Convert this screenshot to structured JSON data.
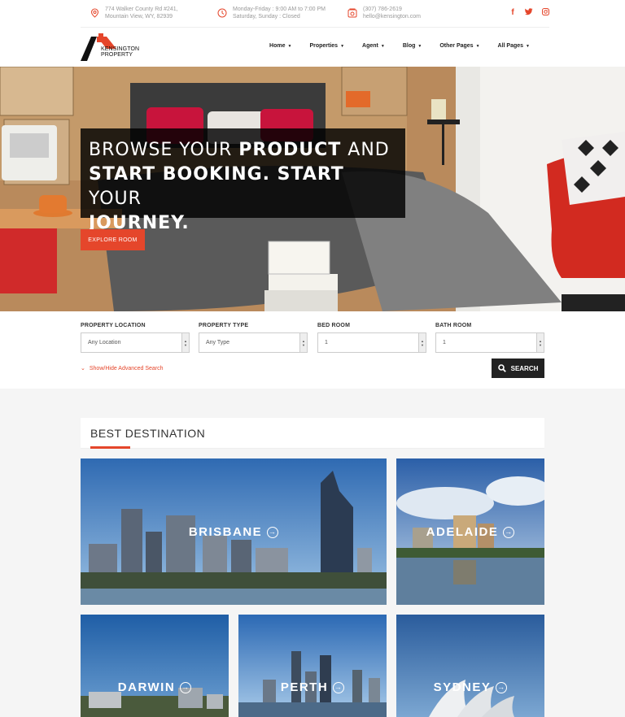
{
  "topbar": {
    "address_line1": "774 Walker County Rd #241,",
    "address_line2": "Mountain View, WY, 82939",
    "hours_line1": "Monday-Friday : 9:00 AM to 7:00 PM",
    "hours_line2": "Saturday, Sunday : Closed",
    "phone": "(307) 786-2619",
    "email": "hello@kensington.com",
    "icons": [
      "map-pin-icon",
      "clock-icon",
      "phone-icon"
    ],
    "social": [
      "f",
      "t",
      "o"
    ]
  },
  "logo": {
    "line1": "KENSINGTON",
    "line2": "PROPERTY"
  },
  "nav": [
    {
      "label": "Home"
    },
    {
      "label": "Properties"
    },
    {
      "label": "Agent"
    },
    {
      "label": "Blog"
    },
    {
      "label": "Other Pages"
    },
    {
      "label": "All Pages"
    }
  ],
  "hero": {
    "l1_a": "BROWSE YOUR ",
    "l1_b": "PRODUCT",
    "l1_c": " AND",
    "l2_a": "START BOOKING. START",
    "l2_b": " YOUR",
    "l3": "JOURNEY.",
    "button": "EXPLORE ROOM"
  },
  "search": {
    "fields": [
      {
        "label": "PROPERTY LOCATION",
        "value": "Any Location"
      },
      {
        "label": "PROPERTY TYPE",
        "value": "Any Type"
      },
      {
        "label": "BED ROOM",
        "value": "1"
      },
      {
        "label": "BATH ROOM",
        "value": "1"
      }
    ],
    "advanced": "Show/Hide Advanced Search",
    "button": "SEARCH"
  },
  "section": {
    "title": "BEST DESTINATION"
  },
  "destinations": [
    {
      "name": "BRISBANE"
    },
    {
      "name": "ADELAIDE"
    },
    {
      "name": "DARWIN"
    },
    {
      "name": "PERTH"
    },
    {
      "name": "SYDNEY"
    }
  ],
  "colors": {
    "accent": "#e5462b",
    "dark": "#222222"
  }
}
